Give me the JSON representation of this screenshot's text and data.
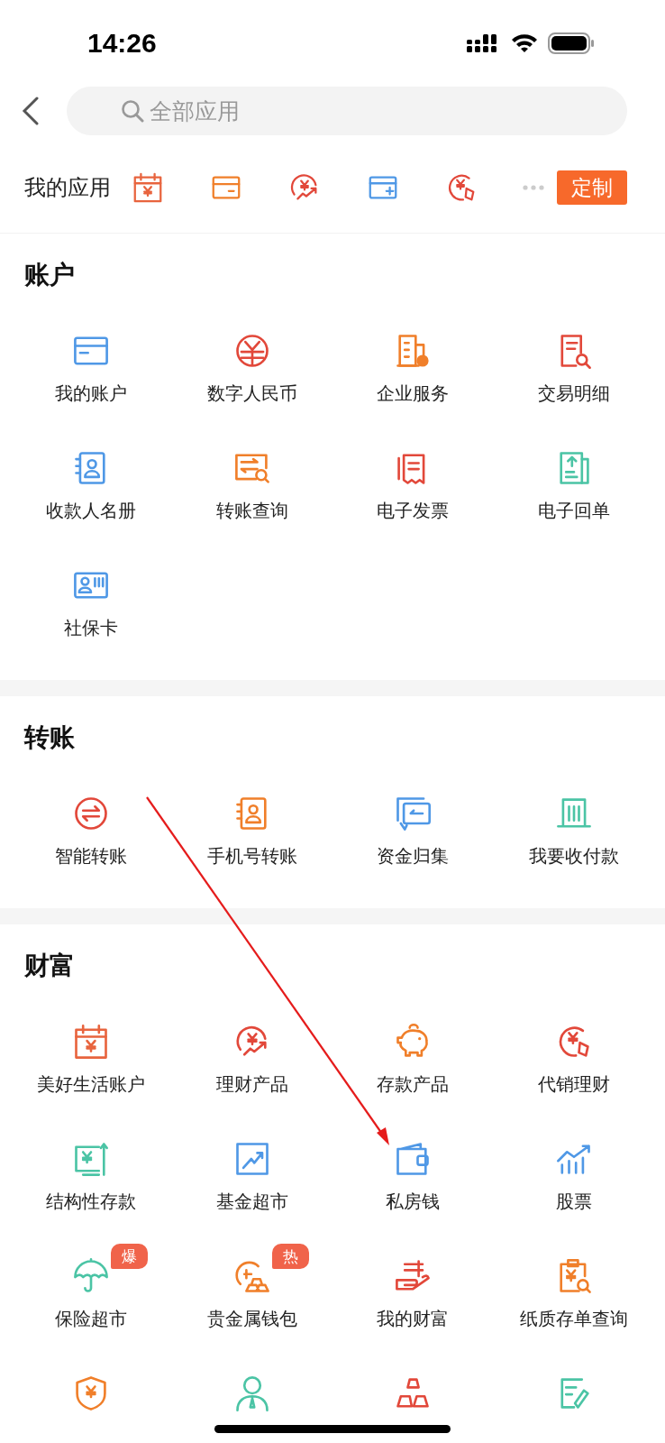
{
  "status_bar": {
    "time": "14:26"
  },
  "search": {
    "placeholder": "全部应用"
  },
  "my_apps": {
    "title": "我的应用",
    "customize_button": "定制"
  },
  "sections": [
    {
      "title": "账户",
      "items": [
        {
          "kind": "tile",
          "label": "我的账户"
        },
        {
          "kind": "tile",
          "label": "数字人民币"
        },
        {
          "kind": "tile",
          "label": "企业服务"
        },
        {
          "kind": "tile",
          "label": "交易明细"
        },
        {
          "kind": "tile",
          "label": "收款人名册"
        },
        {
          "kind": "tile",
          "label": "转账查询"
        },
        {
          "kind": "tile",
          "label": "电子发票"
        },
        {
          "kind": "tile",
          "label": "电子回单"
        },
        {
          "kind": "tile",
          "label": "社保卡"
        }
      ]
    },
    {
      "title": "转账",
      "items": [
        {
          "kind": "tile",
          "label": "智能转账"
        },
        {
          "kind": "tile",
          "label": "手机号转账"
        },
        {
          "kind": "tile",
          "label": "资金归集"
        },
        {
          "kind": "tile",
          "label": "我要收付款"
        }
      ]
    },
    {
      "title": "财富",
      "items": [
        {
          "kind": "tile",
          "label": "美好生活账户"
        },
        {
          "kind": "tile",
          "label": "理财产品"
        },
        {
          "kind": "tile",
          "label": "存款产品"
        },
        {
          "kind": "tile",
          "label": "代销理财"
        },
        {
          "kind": "tile",
          "label": "结构性存款"
        },
        {
          "kind": "tile",
          "label": "基金超市"
        },
        {
          "kind": "tile",
          "label": "私房钱"
        },
        {
          "kind": "tile",
          "label": "股票"
        },
        {
          "kind": "tile",
          "label": "保险超市",
          "badge": "爆"
        },
        {
          "kind": "tile",
          "label": "贵金属钱包",
          "badge": "热"
        },
        {
          "kind": "tile",
          "label": "我的财富"
        },
        {
          "kind": "tile",
          "label": "纸质存单查询"
        },
        {
          "kind": "icon_only"
        },
        {
          "kind": "icon_only"
        },
        {
          "kind": "icon_only"
        },
        {
          "kind": "icon_only"
        }
      ]
    }
  ],
  "annotation": {
    "kind": "arrow"
  }
}
